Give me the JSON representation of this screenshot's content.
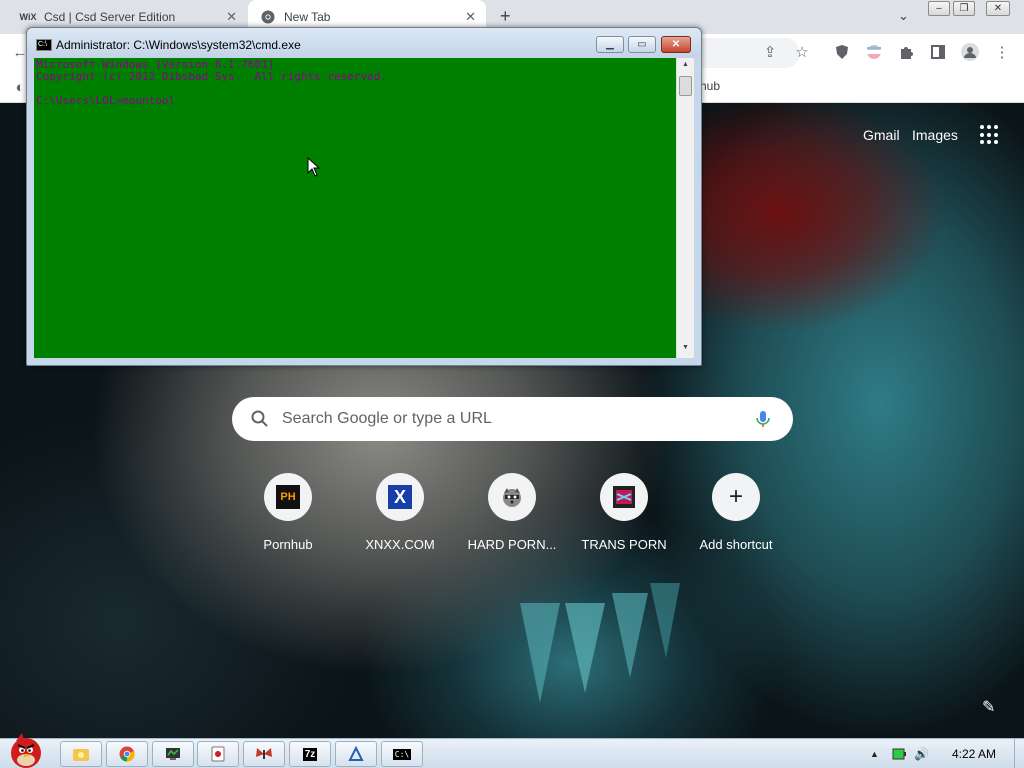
{
  "browser": {
    "tabs": [
      {
        "title": "Csd | Csd Server Edition",
        "favicon": "wix-logo-icon",
        "favicon_text": "WiX",
        "active": false
      },
      {
        "title": "New Tab",
        "favicon": "chrome-icon",
        "active": true
      }
    ],
    "new_tab_symbol": "+",
    "bookmark_partial": "hub"
  },
  "ntp": {
    "gmail": "Gmail",
    "images": "Images",
    "search_placeholder": "Search Google or type a URL",
    "shortcuts": [
      {
        "label": "Pornhub",
        "icon": "ph-logo-icon",
        "icon_text": "PH"
      },
      {
        "label": "XNXX.COM",
        "icon": "x-logo-icon",
        "icon_text": "X"
      },
      {
        "label": "HARD PORN...",
        "icon": "raccoon-icon"
      },
      {
        "label": "TRANS PORN",
        "icon": "site-favicon-icon"
      },
      {
        "label": "Add shortcut",
        "icon": "plus-icon",
        "icon_text": "+"
      }
    ]
  },
  "cmd": {
    "title": "Administrator: C:\\Windows\\system32\\cmd.exe",
    "lines": [
      "Microsoft Windows [Version 6.1.7601]",
      "Copyright (c) 2012 Dibsbad Sys.  All rights reserved.",
      "",
      "C:\\Users\\LOL>mountool"
    ],
    "colors": {
      "background": "#008000",
      "text": "#8b008b"
    }
  },
  "taskbar": {
    "clock": "4:22 AM",
    "show_hidden_symbol": "▲",
    "buttons": [
      {
        "name": "explorer-icon"
      },
      {
        "name": "chrome-icon"
      },
      {
        "name": "network-monitor-icon"
      },
      {
        "name": "card-game-icon"
      },
      {
        "name": "butterfly-app-icon"
      },
      {
        "name": "7zip-icon",
        "text": "7z"
      },
      {
        "name": "triangle-app-icon"
      },
      {
        "name": "cmd-icon",
        "text": "C:\\"
      }
    ]
  }
}
